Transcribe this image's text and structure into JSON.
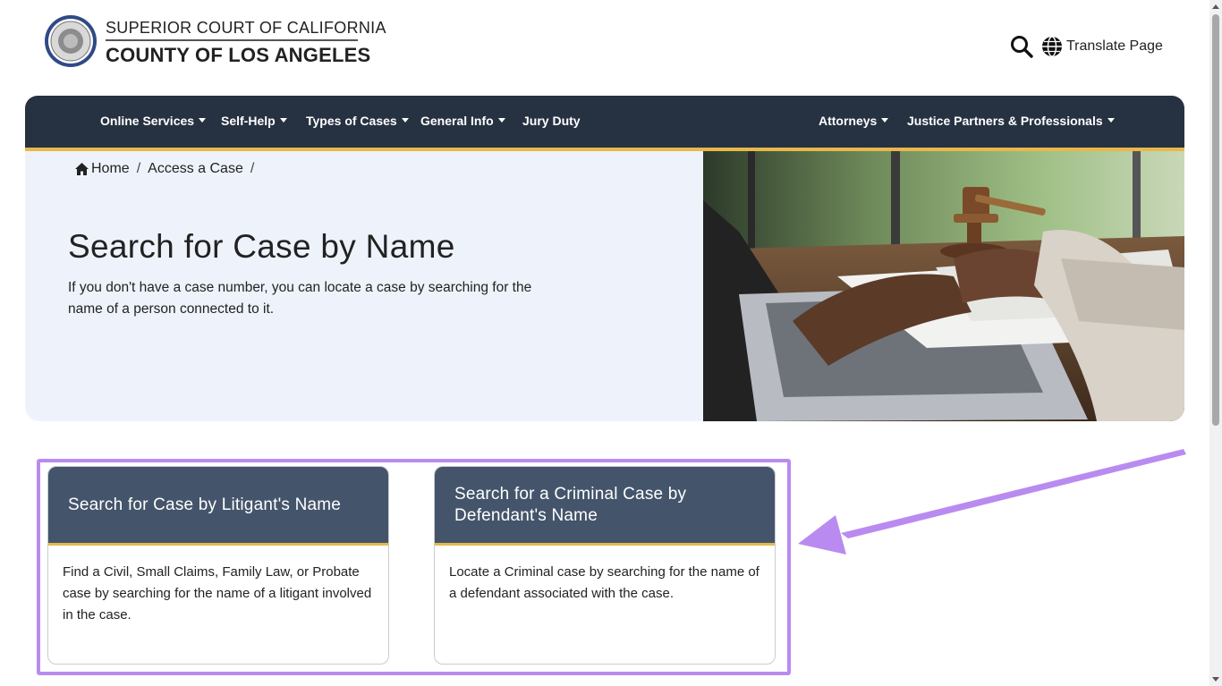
{
  "header": {
    "title_top": "SUPERIOR COURT OF CALIFORNIA",
    "title_bottom": "COUNTY OF LOS ANGELES",
    "translate_label": "Translate Page",
    "seal_icon": "court-seal-icon",
    "search_icon": "search-icon",
    "globe_icon": "globe-icon"
  },
  "nav": {
    "left": [
      "Online Services",
      "Self-Help",
      "Types of Cases",
      "General Info",
      "Jury Duty"
    ],
    "right": [
      "Attorneys",
      "Justice Partners & Professionals"
    ]
  },
  "breadcrumb": {
    "home": "Home",
    "item1": "Access a Case",
    "sep": "/"
  },
  "hero": {
    "title": "Search for Case by Name",
    "description": "If you don't have a case number, you can locate a case by searching for the name of a person connected to it."
  },
  "cards": [
    {
      "title": "Search for Case by Litigant's Name",
      "body": "Find a Civil, Small Claims, Family Law, or Probate case by searching for the name of a litigant involved in the case."
    },
    {
      "title": "Search for a Criminal Case by Defendant's Name",
      "body": "Locate a Criminal case by searching for the name of a defendant associated with the case."
    }
  ],
  "colors": {
    "nav_bg": "#263241",
    "accent_gold": "#e8b84a",
    "card_head": "#44556b",
    "hero_bg": "#eef3fb",
    "highlight": "#b98bf0"
  }
}
